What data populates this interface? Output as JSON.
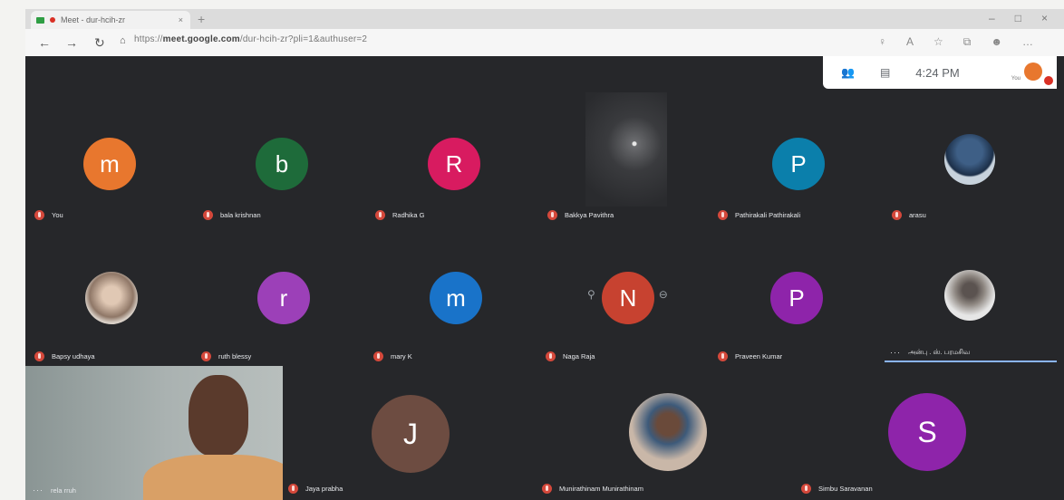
{
  "browser": {
    "tab_title": "Meet - dur-hcih-zr",
    "url_prefix": "https://",
    "url_domain": "meet.google.com",
    "url_path": "/dur-hcih-zr?pli=1&authuser=2"
  },
  "meet_bar": {
    "time": "4:24 PM",
    "you_label": "You"
  },
  "participants": {
    "row1": [
      {
        "initial": "m",
        "name": "You",
        "color": "#e8772e"
      },
      {
        "initial": "b",
        "name": "bala krishnan",
        "color": "#1e6b3a"
      },
      {
        "initial": "R",
        "name": "Radhika G",
        "color": "#d81b60"
      },
      {
        "initial": "",
        "name": "Bakkya Pavithra",
        "color": "#2e3033"
      },
      {
        "initial": "P",
        "name": "Pathirakali Pathirakali",
        "color": "#0b7fab"
      },
      {
        "initial": "",
        "name": "arasu",
        "color": "#4a6b8a"
      }
    ],
    "row2": [
      {
        "initial": "",
        "name": "Bapsy udhaya",
        "color": "#b89f8e"
      },
      {
        "initial": "r",
        "name": "ruth blessy",
        "color": "#9c40b8"
      },
      {
        "initial": "m",
        "name": "mary K",
        "color": "#1973c9"
      },
      {
        "initial": "N",
        "name": "Naga Raja",
        "color": "#c74230"
      },
      {
        "initial": "P",
        "name": "Praveen Kumar",
        "color": "#8e24aa"
      },
      {
        "initial": "",
        "name": "அன்பு . ஸ். பரமசிவ",
        "color": "#d9d9d9"
      }
    ],
    "row3": [
      {
        "initial": "",
        "name": "rela rruh",
        "color": "#9aa2a2"
      },
      {
        "initial": "J",
        "name": "Jaya prabha",
        "color": "#6d4c41"
      },
      {
        "initial": "",
        "name": "Munirathinam Munirathinam",
        "color": "#c9b7a8"
      },
      {
        "initial": "S",
        "name": "Simbu Saravanan",
        "color": "#8e24aa"
      }
    ]
  }
}
